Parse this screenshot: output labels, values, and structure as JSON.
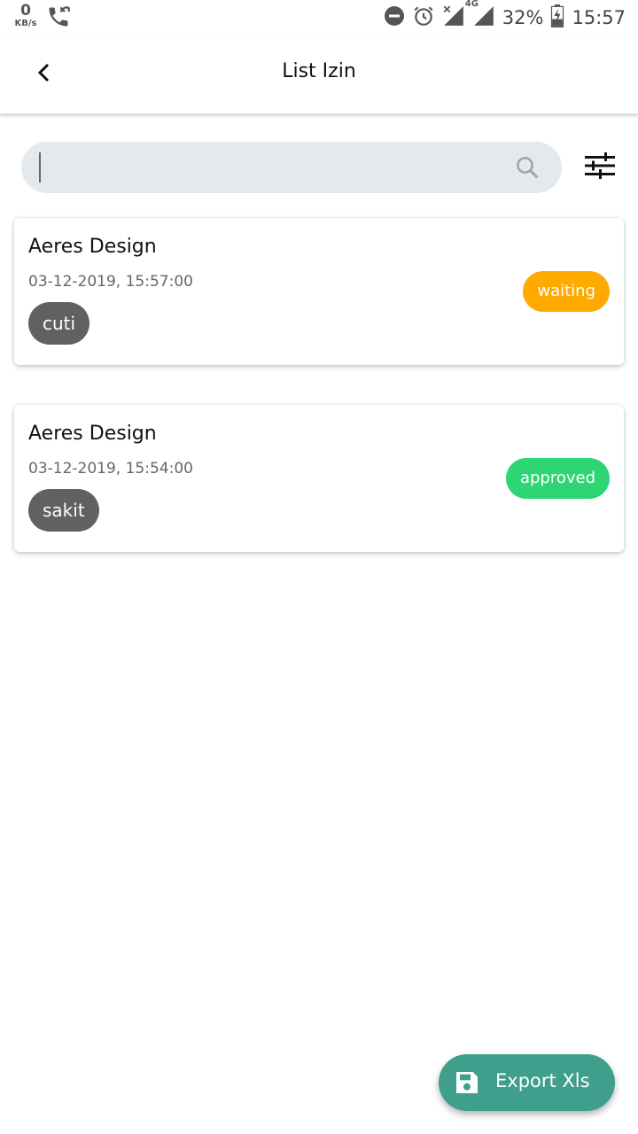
{
  "status_bar": {
    "net_speed_value": "0",
    "net_speed_unit": "KB/s",
    "battery": "32%",
    "time": "15:57",
    "network": "4G",
    "icons": [
      "missed-call-icon",
      "dnd-icon",
      "alarm-icon",
      "signal-icon",
      "battery-icon"
    ]
  },
  "appbar": {
    "title": "List Izin",
    "back_icon": "chevron-left-icon"
  },
  "search": {
    "value": "",
    "placeholder": "",
    "icon": "search-icon",
    "filter_icon": "tune-icon"
  },
  "items": [
    {
      "name": "Aeres Design",
      "datetime": "03-12-2019, 15:57:00",
      "type": "cuti",
      "status": "waiting",
      "status_color": "#FFAA00"
    },
    {
      "name": "Aeres Design",
      "datetime": "03-12-2019, 15:54:00",
      "type": "sakit",
      "status": "approved",
      "status_color": "#2ED573"
    }
  ],
  "fab": {
    "label": "Export Xls",
    "icon": "save-icon",
    "color": "#3F9E8C"
  },
  "colors": {
    "search_bg": "#E3E9EC",
    "chip_bg": "#616161"
  }
}
